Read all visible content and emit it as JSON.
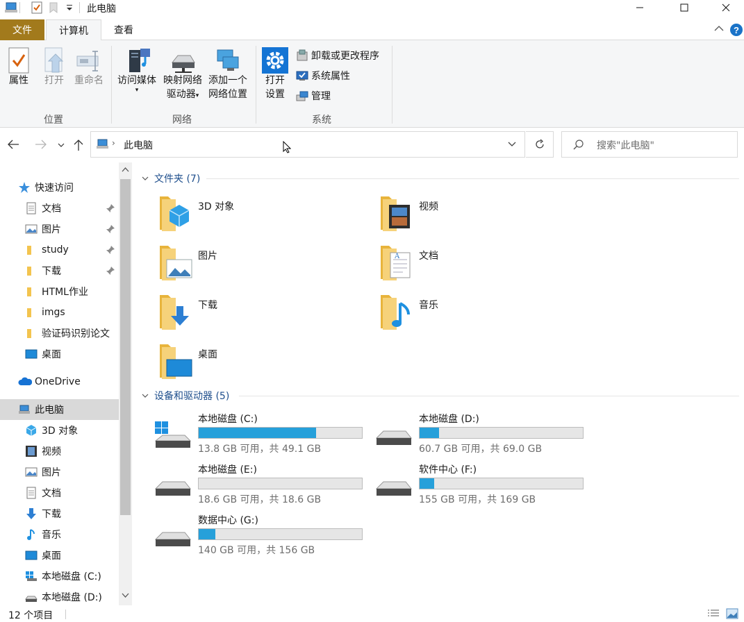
{
  "window": {
    "title": "此电脑"
  },
  "ribbon_tabs": {
    "file": "文件",
    "computer": "计算机",
    "view": "查看"
  },
  "ribbon": {
    "location": {
      "label": "位置",
      "properties": "属性",
      "open": "打开",
      "rename": "重命名"
    },
    "network": {
      "label": "网络",
      "access_media": "访问媒体",
      "map_drive_1": "映射网络",
      "map_drive_2": "驱动器",
      "add_location_1": "添加一个",
      "add_location_2": "网络位置"
    },
    "system": {
      "label": "系统",
      "open_settings_1": "打开",
      "open_settings_2": "设置",
      "uninstall": "卸载或更改程序",
      "system_properties": "系统属性",
      "manage": "管理"
    }
  },
  "address": {
    "path": "此电脑",
    "search_placeholder": "搜索\"此电脑\""
  },
  "sidebar": {
    "quick_access": "快速访问",
    "quick_items": [
      "文档",
      "图片",
      "study",
      "下载",
      "HTML作业",
      "imgs",
      "验证码识别论文",
      "桌面"
    ],
    "onedrive": "OneDrive",
    "this_pc": "此电脑",
    "pc_items": [
      "3D 对象",
      "视频",
      "图片",
      "文档",
      "下载",
      "音乐",
      "桌面",
      "本地磁盘 (C:)",
      "本地磁盘 (D:)"
    ]
  },
  "folders": {
    "header": "文件夹 (7)",
    "items": [
      "3D 对象",
      "视频",
      "图片",
      "文档",
      "下载",
      "音乐",
      "桌面"
    ]
  },
  "drives": {
    "header": "设备和驱动器 (5)",
    "items": [
      {
        "name": "本地磁盘 (C:)",
        "info": "13.8 GB 可用，共 49.1 GB",
        "used_fraction": 0.72
      },
      {
        "name": "本地磁盘 (D:)",
        "info": "60.7 GB 可用，共 69.0 GB",
        "used_fraction": 0.12
      },
      {
        "name": "本地磁盘 (E:)",
        "info": "18.6 GB 可用，共 18.6 GB",
        "used_fraction": 0.0
      },
      {
        "name": "软件中心 (F:)",
        "info": "155 GB 可用，共 169 GB",
        "used_fraction": 0.09
      },
      {
        "name": "数据中心 (G:)",
        "info": "140 GB 可用，共 156 GB",
        "used_fraction": 0.1
      }
    ]
  },
  "status": {
    "count": "12 个项目"
  },
  "colors": {
    "accent": "#26a0da",
    "file_tab": "#a27a1c",
    "folder": "#f3c44f",
    "section_header": "#1e4e8c"
  }
}
